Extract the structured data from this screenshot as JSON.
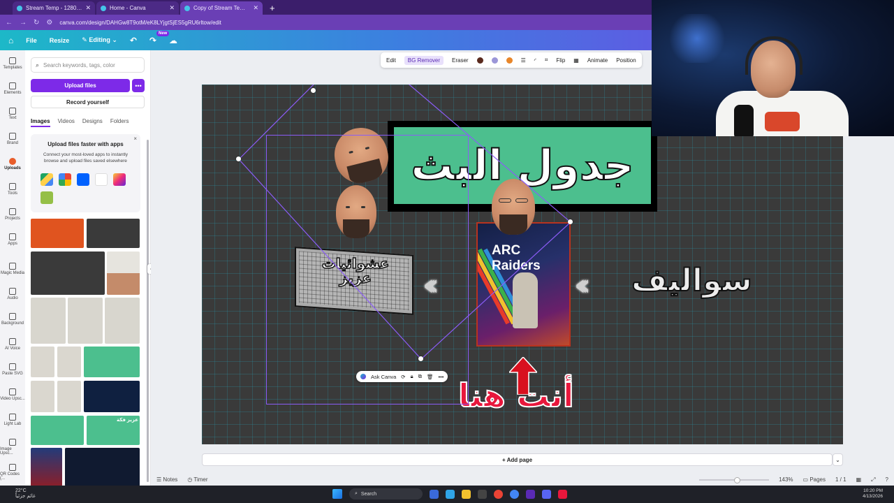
{
  "browser": {
    "tabs": [
      {
        "title": "Stream Temp - 1280 × 720px",
        "active": false
      },
      {
        "title": "Home - Canva",
        "active": false
      },
      {
        "title": "Copy of Stream Temp - 1280 ×",
        "active": true
      }
    ],
    "url": "canva.com/design/DAHGw8T9otM/eK8LYjgtSjES5gRU6rltow/edit"
  },
  "header": {
    "file": "File",
    "resize": "Resize",
    "editing": "Editing",
    "new_badge": "New"
  },
  "rail": [
    {
      "label": "Templates"
    },
    {
      "label": "Elements"
    },
    {
      "label": "Text"
    },
    {
      "label": "Brand"
    },
    {
      "label": "Uploads",
      "active": true
    },
    {
      "label": "Tools"
    },
    {
      "label": "Projects"
    },
    {
      "label": "Apps"
    },
    {
      "label": "Magic Media"
    },
    {
      "label": "Audio"
    },
    {
      "label": "Background"
    },
    {
      "label": "AI Voice"
    },
    {
      "label": "Paste SVG"
    },
    {
      "label": "Video Upsc..."
    },
    {
      "label": "Light Lab"
    },
    {
      "label": "Image Upsc..."
    },
    {
      "label": "QR Codes (..."
    }
  ],
  "panel": {
    "search_placeholder": "Search keywords, tags, color",
    "upload_label": "Upload files",
    "more_label": "•••",
    "record_label": "Record yourself",
    "tabs": [
      "Images",
      "Videos",
      "Designs",
      "Folders"
    ],
    "promo_title": "Upload files faster with apps",
    "promo_body": "Connect your most-loved apps to instantly browse and upload files saved elsewhere",
    "promo_close": "×",
    "thumb_label": "عزيز فكة"
  },
  "toolbar": {
    "edit": "Edit",
    "bg_remover": "BG Remover",
    "eraser": "Eraser",
    "flip": "Flip",
    "animate": "Animate",
    "position": "Position"
  },
  "design": {
    "title": "جدول البث",
    "tag": "عشوائيات عزيز",
    "topics": "سواليف",
    "you_here": "أنت هنا",
    "game_title": "ARC Raiders",
    "chevrons": "‹‹‹"
  },
  "floatbar": {
    "ask_canva": "Ask Canva"
  },
  "footer": {
    "add_page": "+ Add page",
    "notes": "Notes",
    "timer": "Timer",
    "zoom": "143%",
    "pages": "Pages",
    "page_count": "1 / 1"
  },
  "taskbar": {
    "temp": "22°C",
    "weather": "غائم جزئياً",
    "search": "Search",
    "time": "10:20 PM",
    "date": "4/13/2026"
  },
  "colors": {
    "brand_purple": "#7d2ae8",
    "title_green": "#4cbf8e",
    "you_here_red": "#e8173c",
    "canvas_bg": "#3a3a3a"
  }
}
